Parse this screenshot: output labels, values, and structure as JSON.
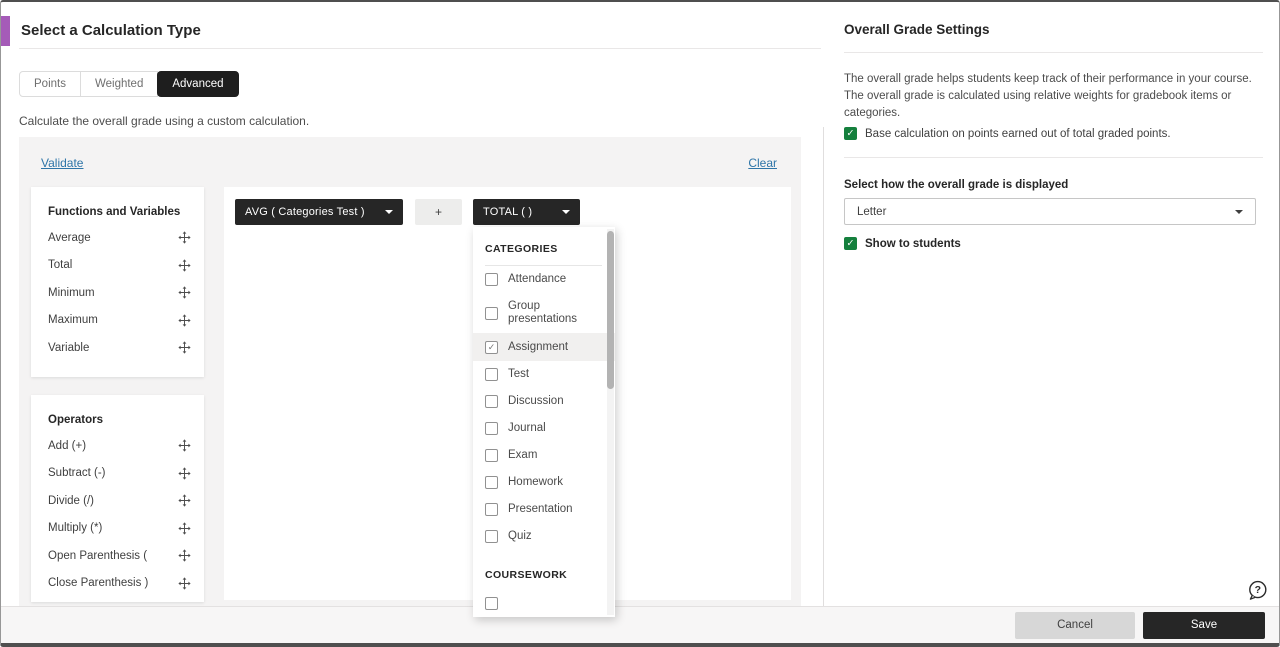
{
  "left_panel": {
    "title": "Select a Calculation Type",
    "tabs": [
      {
        "label": "Points",
        "active": false
      },
      {
        "label": "Weighted",
        "active": false
      },
      {
        "label": "Advanced",
        "active": true
      }
    ],
    "description": "Calculate the overall grade using a custom calculation.",
    "calculation": {
      "validate_label": "Validate",
      "clear_label": "Clear",
      "functions_panel": {
        "title": "Functions and Variables",
        "items": [
          "Average",
          "Total",
          "Minimum",
          "Maximum",
          "Variable"
        ]
      },
      "operators_panel": {
        "title": "Operators",
        "items": [
          "Add (+)",
          "Subtract (-)",
          "Divide (/)",
          "Multiply (*)",
          "Open Parenthesis (",
          "Close Parenthesis )"
        ]
      },
      "formula": {
        "avg_label": "AVG ( Categories Test )",
        "plus_label": "+",
        "total_label": "TOTAL ( )"
      },
      "category_dropdown": {
        "header_categories": "CATEGORIES",
        "options": [
          {
            "label": "Attendance",
            "checked": false
          },
          {
            "label": "Group presentations",
            "checked": false
          },
          {
            "label": "Assignment",
            "checked": true
          },
          {
            "label": "Test",
            "checked": false
          },
          {
            "label": "Discussion",
            "checked": false
          },
          {
            "label": "Journal",
            "checked": false
          },
          {
            "label": "Exam",
            "checked": false
          },
          {
            "label": "Homework",
            "checked": false
          },
          {
            "label": "Presentation",
            "checked": false
          },
          {
            "label": "Quiz",
            "checked": false
          }
        ],
        "header_coursework": "COURSEWORK"
      }
    }
  },
  "right_panel": {
    "title": "Overall Grade Settings",
    "description": "The overall grade helps students keep track of their performance in your course. The overall grade is calculated using relative weights for gradebook items or categories.",
    "base_points_checkbox": {
      "label": "Base calculation on points earned out of total graded points.",
      "checked": true
    },
    "display_section": {
      "label": "Select how the overall grade is displayed",
      "selected": "Letter"
    },
    "show_to_students": {
      "label": "Show to students",
      "checked": true
    }
  },
  "footer": {
    "cancel_label": "Cancel",
    "save_label": "Save"
  },
  "help": {
    "glyph": "?"
  },
  "colors": {
    "accent_purple": "#a55bb8",
    "checkbox_green": "#15803d",
    "link_blue": "#2e75a8",
    "button_black": "#262626"
  }
}
